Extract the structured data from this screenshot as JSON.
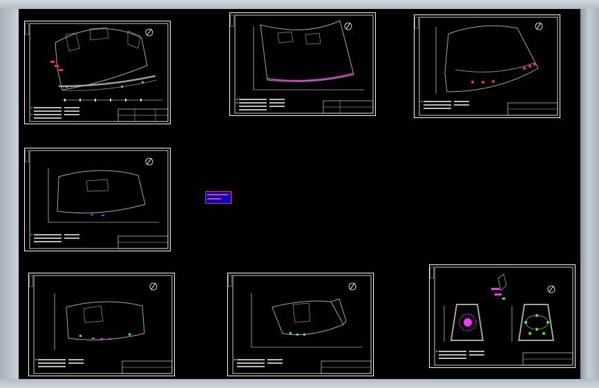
{
  "app": {
    "view": "CAD model space",
    "sheet_count": 7
  },
  "colors": {
    "background": "#000000",
    "frame": "#ffffff",
    "linework": "#a6a6a6",
    "magenta_fixture": "#ff33ff",
    "red_fixture": "#ff3333",
    "green_fixture": "#33ff33",
    "blue_fixture": "#3366ff",
    "tag_fill": "#0000cc"
  },
  "sheets": [
    {
      "id": "sheet-1",
      "plan": "arc-floor-plan-full",
      "fixtures": [
        "red",
        "cyan"
      ]
    },
    {
      "id": "sheet-2",
      "plan": "arc-floor-plan-upper",
      "fixtures": [
        "magenta"
      ]
    },
    {
      "id": "sheet-3",
      "plan": "arc-floor-plan-stage",
      "fixtures": [
        "red"
      ]
    },
    {
      "id": "sheet-4",
      "plan": "arc-floor-plan-lower",
      "fixtures": [
        "blue"
      ]
    },
    {
      "id": "sheet-5",
      "plan": "arc-floor-plan-wing",
      "fixtures": [
        "magenta",
        "green"
      ]
    },
    {
      "id": "sheet-6",
      "plan": "fan-floor-plan",
      "fixtures": [
        "green"
      ]
    },
    {
      "id": "sheet-7",
      "plan": "trapezoid-details",
      "fixtures": [
        "magenta",
        "green"
      ]
    }
  ],
  "icons": {
    "north_arrow": "north-arrow-icon",
    "layer_tag": "layer-tag-icon"
  }
}
